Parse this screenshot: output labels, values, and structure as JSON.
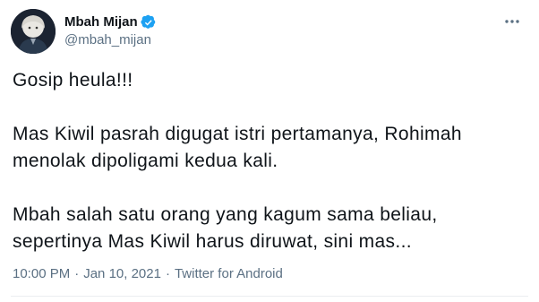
{
  "author": {
    "display_name": "Mbah Mijan",
    "handle": "@mbah_mijan",
    "verified": true,
    "verified_badge_color": "#1da1f2"
  },
  "tweet": {
    "paragraphs": [
      "Gosip heula!!!",
      "Mas Kiwil pasrah digugat istri pertamanya, Rohimah menolak dipoligami kedua kali.",
      "Mbah salah satu orang yang kagum sama beliau, sepertinya Mas Kiwil harus diruwat, sini mas..."
    ]
  },
  "meta": {
    "time": "10:00 PM",
    "separator": "·",
    "date": "Jan 10, 2021",
    "source": "Twitter for Android"
  },
  "icons": {
    "verified": "verified-badge-icon",
    "more": "more-options-icon"
  }
}
